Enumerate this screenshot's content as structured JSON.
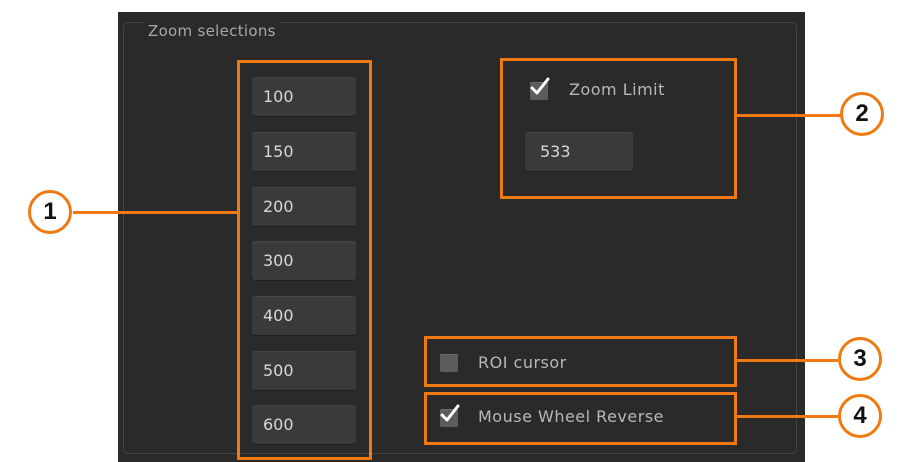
{
  "group_title": "Zoom selections",
  "zoom_values": [
    "100",
    "150",
    "200",
    "300",
    "400",
    "500",
    "600"
  ],
  "zoom_limit": {
    "label": "Zoom Limit",
    "checked": true,
    "value": "533"
  },
  "roi_cursor": {
    "label": "ROI cursor",
    "checked": false
  },
  "mouse_wheel_reverse": {
    "label": "Mouse Wheel Reverse",
    "checked": true
  },
  "callouts": [
    "1",
    "2",
    "3",
    "4"
  ],
  "accent_color": "#f07a12",
  "panel_color": "#2a2a2a"
}
